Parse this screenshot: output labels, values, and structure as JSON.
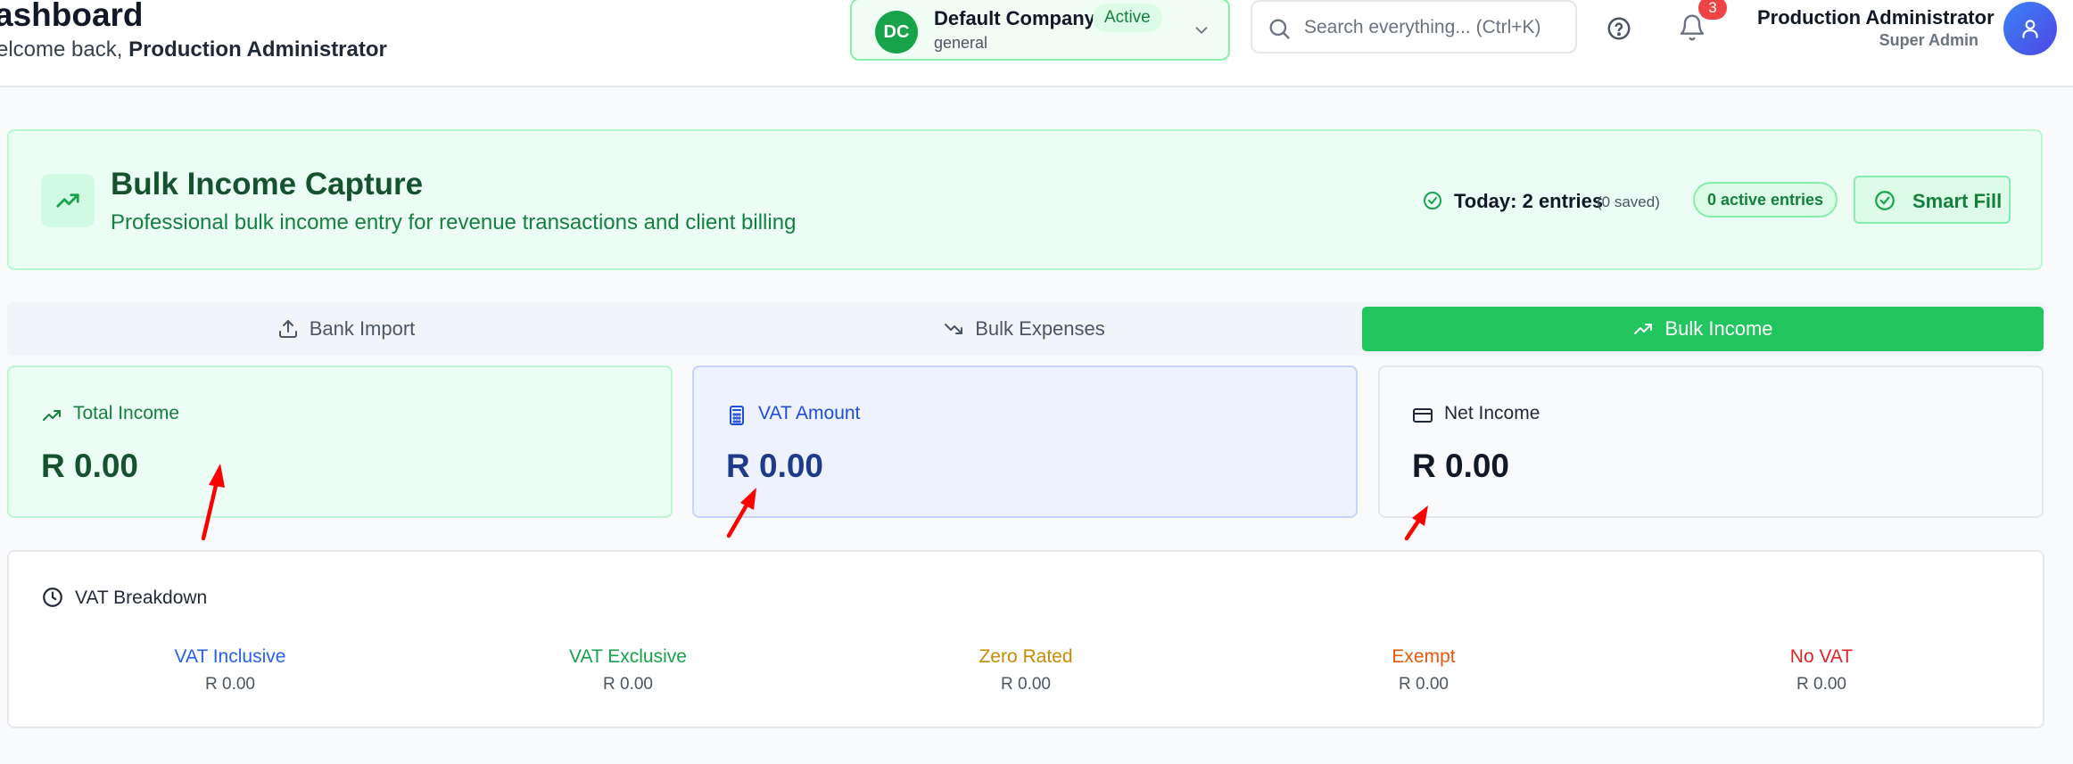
{
  "header": {
    "title": "ashboard",
    "welcome_prefix": "elcome back, ",
    "welcome_name": "Production Administrator",
    "company": {
      "initials": "DC",
      "name": "Default Company",
      "status": "Active",
      "subtitle": "general"
    },
    "search": {
      "placeholder": "Search everything... (Ctrl+K)"
    },
    "notifications": {
      "count": "3"
    },
    "user": {
      "name": "Production Administrator",
      "role": "Super Admin"
    }
  },
  "hero": {
    "title": "Bulk Income Capture",
    "subtitle": "Professional bulk income entry for revenue transactions and client billing",
    "today": "Today: 2 entries",
    "saved": "(0 saved)",
    "active_entries": "0 active entries",
    "smart_fill": "Smart Fill"
  },
  "tabs": [
    {
      "label": "Bank Import",
      "icon": "upload-icon"
    },
    {
      "label": "Bulk Expenses",
      "icon": "trending-down-icon"
    },
    {
      "label": "Bulk Income",
      "icon": "trending-up-icon",
      "active": true
    }
  ],
  "stats": [
    {
      "label": "Total Income",
      "value": "R 0.00",
      "icon": "trending-up-icon"
    },
    {
      "label": "VAT Amount",
      "value": "R 0.00",
      "icon": "calculator-icon"
    },
    {
      "label": "Net Income",
      "value": "R 0.00",
      "icon": "credit-card-icon"
    }
  ],
  "vat_breakdown": {
    "title": "VAT Breakdown",
    "items": [
      {
        "label": "VAT Inclusive",
        "value": "R 0.00",
        "color": "#2563eb"
      },
      {
        "label": "VAT Exclusive",
        "value": "R 0.00",
        "color": "#16a34a"
      },
      {
        "label": "Zero Rated",
        "value": "R 0.00",
        "color": "#ca8a04"
      },
      {
        "label": "Exempt",
        "value": "R 0.00",
        "color": "#ea580c"
      },
      {
        "label": "No VAT",
        "value": "R 0.00",
        "color": "#dc2626"
      }
    ]
  },
  "colors": {
    "primary_green": "#22c55e",
    "annotation_arrow": "#ff0000"
  }
}
